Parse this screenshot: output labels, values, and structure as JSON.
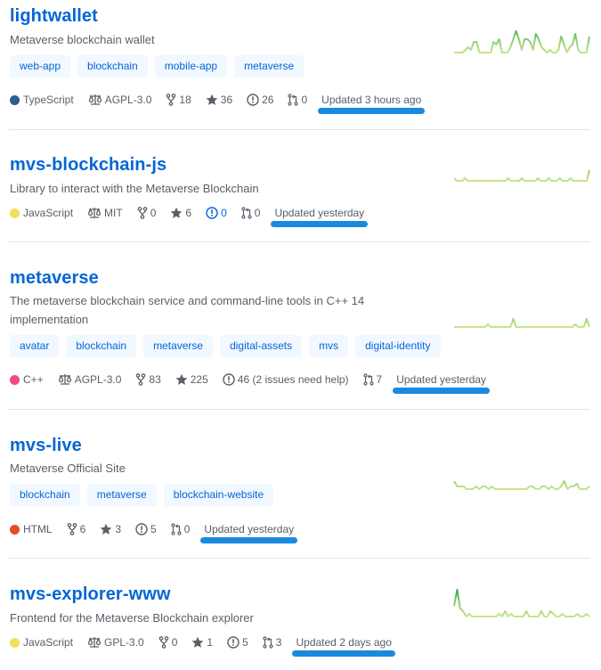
{
  "colors": {
    "link": "#0366d6",
    "topic_bg": "#f1f8ff",
    "muted": "#586069",
    "highlight_mark": "#1a8ae0",
    "spark_light": "#c6e48b",
    "spark_dark": "#239a3b"
  },
  "repos": [
    {
      "name": "lightwallet",
      "description": "Metaverse blockchain wallet",
      "topics": [
        "web-app",
        "blockchain",
        "mobile-app",
        "metaverse"
      ],
      "language": "TypeScript",
      "language_color": "#2b5d8f",
      "license": "AGPL-3.0",
      "forks": "18",
      "stars": "36",
      "issues": "26",
      "pull_requests": "0",
      "updated": "Updated 3 hours ago",
      "activity": [
        0,
        0,
        0,
        0,
        1,
        2,
        1,
        4,
        4,
        0,
        0,
        0,
        0,
        0,
        4,
        3,
        5,
        0,
        0,
        0,
        2,
        5,
        8,
        5,
        1,
        5,
        5,
        4,
        1,
        7,
        5,
        2,
        1,
        0,
        1,
        0,
        0,
        1,
        6,
        3,
        0,
        2,
        3,
        7,
        1,
        0,
        0,
        0,
        6
      ]
    },
    {
      "name": "mvs-blockchain-js",
      "description": "Library to interact with the Metaverse Blockchain",
      "topics": [],
      "language": "JavaScript",
      "language_color": "#f1e05a",
      "license": "MIT",
      "forks": "0",
      "stars": "6",
      "issues": "0",
      "issues_highlight": true,
      "pull_requests": "0",
      "updated": "Updated yesterday",
      "activity": [
        1,
        0,
        0,
        0,
        1,
        0,
        0,
        0,
        0,
        0,
        0,
        0,
        0,
        0,
        0,
        0,
        0,
        0,
        0,
        0,
        1,
        0,
        0,
        0,
        0,
        1,
        0,
        0,
        0,
        0,
        0,
        1,
        0,
        0,
        0,
        1,
        0,
        0,
        0,
        1,
        0,
        0,
        0,
        1,
        0,
        0,
        0,
        0,
        0,
        0,
        4
      ]
    },
    {
      "name": "metaverse",
      "description": "The metaverse blockchain service and command-line tools in C++ 14 implementation",
      "topics": [
        "avatar",
        "blockchain",
        "metaverse",
        "digital-assets",
        "mvs",
        "digital-identity"
      ],
      "language": "C++",
      "language_color": "#f34b7d",
      "license": "AGPL-3.0",
      "forks": "83",
      "stars": "225",
      "issues": "46 (2 issues need help)",
      "pull_requests": "7",
      "updated": "Updated yesterday",
      "activity": [
        0,
        0,
        0,
        0,
        0,
        0,
        0,
        0,
        0,
        0,
        0,
        0,
        1,
        0,
        0,
        0,
        0,
        0,
        0,
        0,
        0,
        3,
        0,
        0,
        0,
        0,
        0,
        0,
        0,
        0,
        0,
        0,
        0,
        0,
        0,
        0,
        0,
        0,
        0,
        0,
        0,
        0,
        0,
        1,
        0,
        0,
        0,
        3,
        0
      ]
    },
    {
      "name": "mvs-live",
      "description": "Metaverse Official Site",
      "topics": [
        "blockchain",
        "metaverse",
        "blockchain-website"
      ],
      "language": "HTML",
      "language_color": "#e34c26",
      "license": "",
      "forks": "6",
      "stars": "3",
      "issues": "5",
      "pull_requests": "0",
      "updated": "Updated yesterday",
      "activity": [
        3,
        1,
        1,
        1,
        0,
        0,
        0,
        1,
        0,
        1,
        1,
        0,
        1,
        0,
        0,
        0,
        0,
        0,
        0,
        0,
        0,
        0,
        0,
        0,
        1,
        1,
        0,
        0,
        1,
        1,
        0,
        1,
        0,
        0,
        1,
        3,
        0,
        1,
        1,
        2,
        0,
        0,
        0,
        1
      ]
    },
    {
      "name": "mvs-explorer-www",
      "description": "Frontend for the Metaverse Blockchain explorer",
      "topics": [],
      "language": "JavaScript",
      "language_color": "#f1e05a",
      "license": "GPL-3.0",
      "forks": "0",
      "stars": "1",
      "issues": "5",
      "pull_requests": "3",
      "updated": "Updated 2 days ago",
      "activity": [
        4,
        10,
        3,
        2,
        0,
        1,
        0,
        0,
        0,
        0,
        0,
        0,
        0,
        0,
        0,
        1,
        0,
        2,
        0,
        1,
        0,
        0,
        0,
        0,
        2,
        0,
        0,
        0,
        0,
        2,
        0,
        0,
        2,
        1,
        0,
        0,
        1,
        0,
        0,
        0,
        0,
        1,
        0,
        0,
        1,
        0
      ]
    }
  ]
}
